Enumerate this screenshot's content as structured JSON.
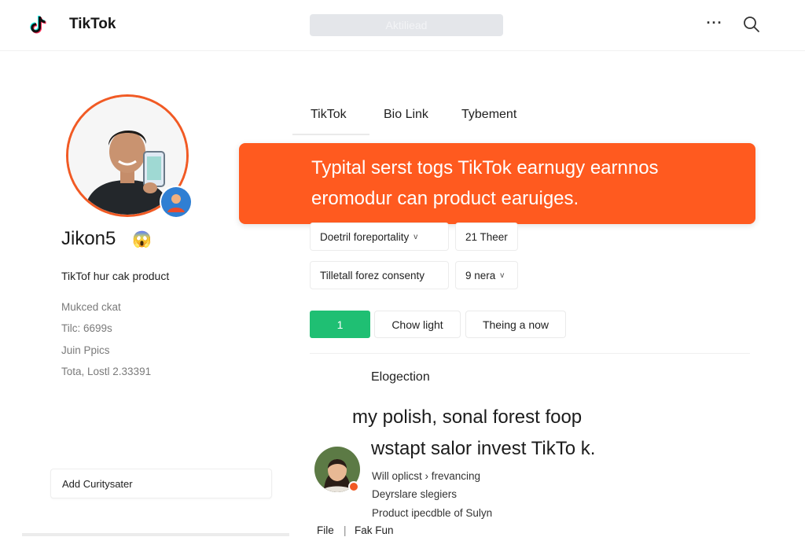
{
  "header": {
    "brand": "TikTok",
    "search_text": "Aktiliead",
    "more_glyph": "···"
  },
  "profile": {
    "username": "Jikon5",
    "username_emoji": "😱",
    "bio": "TikTof hur cak product",
    "meta": [
      "Mukced ckat",
      "Tilc: 6699s",
      "Juin Ppics",
      "Tota, Lostl 2.33391"
    ],
    "add_community": "Add Curitysater"
  },
  "tabs": [
    "TikTok",
    "Bio Link",
    "Tybement"
  ],
  "banner": {
    "line1": "Typital serst togs TikTok earnugy earnnos",
    "line2": "eromodur can product earuiges.",
    "color": "#ff5a1f"
  },
  "filters": {
    "row1": [
      {
        "label": "Doetril foreportality",
        "chevron": "v"
      },
      {
        "label": "21 Theer"
      }
    ],
    "row2": [
      {
        "label": "Tilletall forez consenty"
      },
      {
        "label": "9 nera",
        "chevron": "v"
      }
    ]
  },
  "actions": {
    "green_label": "1",
    "btn2": "Chow light",
    "btn3": "Theing a now",
    "green_color": "#1fbf73"
  },
  "section": {
    "title": "Elogection",
    "line1": "my polish, sonal forest foop",
    "line2": "wstapt salor invest TikTo k.",
    "rows": [
      "Will oplicst  ›  frevancing",
      "Deyrslare slegiers",
      "Product ipecdble of Sulyn"
    ]
  },
  "footer": {
    "link1": "File",
    "sep": "|",
    "link2": "Fak Fun"
  }
}
